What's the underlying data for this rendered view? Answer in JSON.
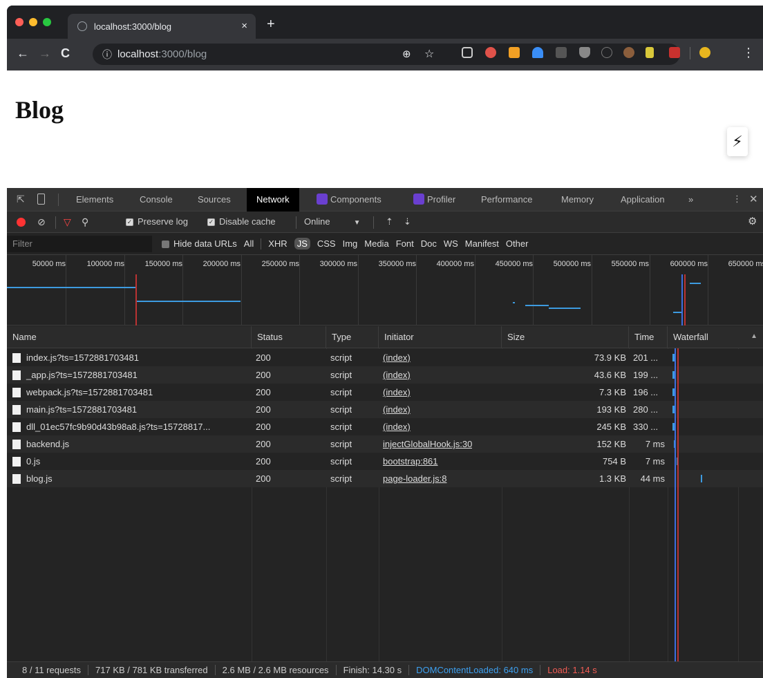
{
  "browser": {
    "tab_title": "localhost:3000/blog",
    "tab_close": "×",
    "new_tab": "+",
    "url_host": "localhost",
    "url_path": ":3000/blog"
  },
  "page": {
    "heading": "Blog",
    "bolt_icon": "⚡"
  },
  "devtools": {
    "tabs": [
      "Elements",
      "Console",
      "Sources",
      "Network",
      "Components",
      "Profiler",
      "Performance",
      "Memory",
      "Application",
      "»"
    ],
    "active_tab": "Network",
    "controls": {
      "preserve_log": "Preserve log",
      "disable_cache": "Disable cache",
      "throttle": "Online"
    },
    "filter": {
      "placeholder": "Filter",
      "hide_data_urls": "Hide data URLs",
      "types": [
        "All",
        "XHR",
        "JS",
        "CSS",
        "Img",
        "Media",
        "Font",
        "Doc",
        "WS",
        "Manifest",
        "Other"
      ],
      "active_type": "JS"
    },
    "overview_ticks": [
      "50000 ms",
      "100000 ms",
      "150000 ms",
      "200000 ms",
      "250000 ms",
      "300000 ms",
      "350000 ms",
      "400000 ms",
      "450000 ms",
      "500000 ms",
      "550000 ms",
      "600000 ms",
      "650000 ms"
    ],
    "columns": [
      "Name",
      "Status",
      "Type",
      "Initiator",
      "Size",
      "Time",
      "Waterfall"
    ],
    "rows": [
      {
        "name": "index.js?ts=1572881703481",
        "status": "200",
        "type": "script",
        "initiator": "(index)",
        "size": "73.9 KB",
        "time": "201 ..."
      },
      {
        "name": "_app.js?ts=1572881703481",
        "status": "200",
        "type": "script",
        "initiator": "(index)",
        "size": "43.6 KB",
        "time": "199 ..."
      },
      {
        "name": "webpack.js?ts=1572881703481",
        "status": "200",
        "type": "script",
        "initiator": "(index)",
        "size": "7.3 KB",
        "time": "196 ..."
      },
      {
        "name": "main.js?ts=1572881703481",
        "status": "200",
        "type": "script",
        "initiator": "(index)",
        "size": "193 KB",
        "time": "280 ..."
      },
      {
        "name": "dll_01ec57fc9b90d43b98a8.js?ts=15728817...",
        "status": "200",
        "type": "script",
        "initiator": "(index)",
        "size": "245 KB",
        "time": "330 ..."
      },
      {
        "name": "backend.js",
        "status": "200",
        "type": "script",
        "initiator": "injectGlobalHook.js:30",
        "size": "152 KB",
        "time": "7 ms"
      },
      {
        "name": "0.js",
        "status": "200",
        "type": "script",
        "initiator": "bootstrap:861",
        "size": "754 B",
        "time": "7 ms"
      },
      {
        "name": "blog.js",
        "status": "200",
        "type": "script",
        "initiator": "page-loader.js:8",
        "size": "1.3 KB",
        "time": "44 ms"
      }
    ],
    "status": {
      "requests": "8 / 11 requests",
      "transferred": "717 KB / 781 KB transferred",
      "resources": "2.6 MB / 2.6 MB resources",
      "finish": "Finish: 14.30 s",
      "dom_loaded": "DOMContentLoaded: 640 ms",
      "load": "Load: 1.14 s"
    }
  }
}
